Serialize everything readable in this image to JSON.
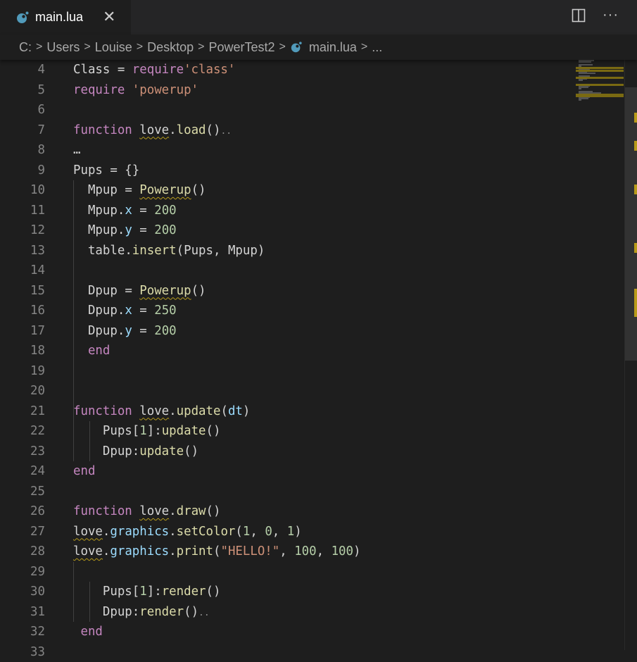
{
  "tab": {
    "title": "main.lua",
    "close": "✕"
  },
  "breadcrumb": {
    "items": [
      "C:",
      "Users",
      "Louise",
      "Desktop",
      "PowerTest2"
    ],
    "file": "main.lua",
    "more": "..."
  },
  "actions": {
    "more": "···"
  },
  "editor": {
    "lines": [
      {
        "n": "4",
        "code": "Class = require'class'"
      },
      {
        "n": "5",
        "code": "require 'powerup'"
      },
      {
        "n": "6",
        "code": ""
      },
      {
        "n": "7",
        "code": "function love.load()"
      },
      {
        "n": "8",
        "code": "..."
      },
      {
        "n": "9",
        "code": "Pups = {}"
      },
      {
        "n": "10",
        "code": "  Mpup = Powerup()"
      },
      {
        "n": "11",
        "code": "  Mpup.x = 200"
      },
      {
        "n": "12",
        "code": "  Mpup.y = 200"
      },
      {
        "n": "13",
        "code": "  table.insert(Pups, Mpup)"
      },
      {
        "n": "14",
        "code": ""
      },
      {
        "n": "15",
        "code": "  Dpup = Powerup()"
      },
      {
        "n": "16",
        "code": "  Dpup.x = 250"
      },
      {
        "n": "17",
        "code": "  Dpup.y = 200"
      },
      {
        "n": "18",
        "code": "  end"
      },
      {
        "n": "19",
        "code": ""
      },
      {
        "n": "20",
        "code": ""
      },
      {
        "n": "21",
        "code": "function love.update(dt)"
      },
      {
        "n": "22",
        "code": "    Pups[1]:update()"
      },
      {
        "n": "23",
        "code": "    Dpup:update()"
      },
      {
        "n": "24",
        "code": "end"
      },
      {
        "n": "25",
        "code": ""
      },
      {
        "n": "26",
        "code": "function love.draw()"
      },
      {
        "n": "27",
        "code": "love.graphics.setColor(1, 0, 1)"
      },
      {
        "n": "28",
        "code": "love.graphics.print(\"HELLO!\", 100, 100)"
      },
      {
        "n": "29",
        "code": ""
      },
      {
        "n": "30",
        "code": "    Pups[1]:render()"
      },
      {
        "n": "31",
        "code": "    Dpup:render()"
      },
      {
        "n": "32",
        "code": " end"
      },
      {
        "n": "33",
        "code": ""
      }
    ]
  },
  "colors": {
    "keyword": "#c586c0",
    "string": "#ce9178",
    "number": "#b5cea8",
    "property": "#9cdcfe",
    "function": "#dcdcaa",
    "line_number": "#858585",
    "background": "#1e1e1e",
    "squiggle": "#b59a1a"
  }
}
